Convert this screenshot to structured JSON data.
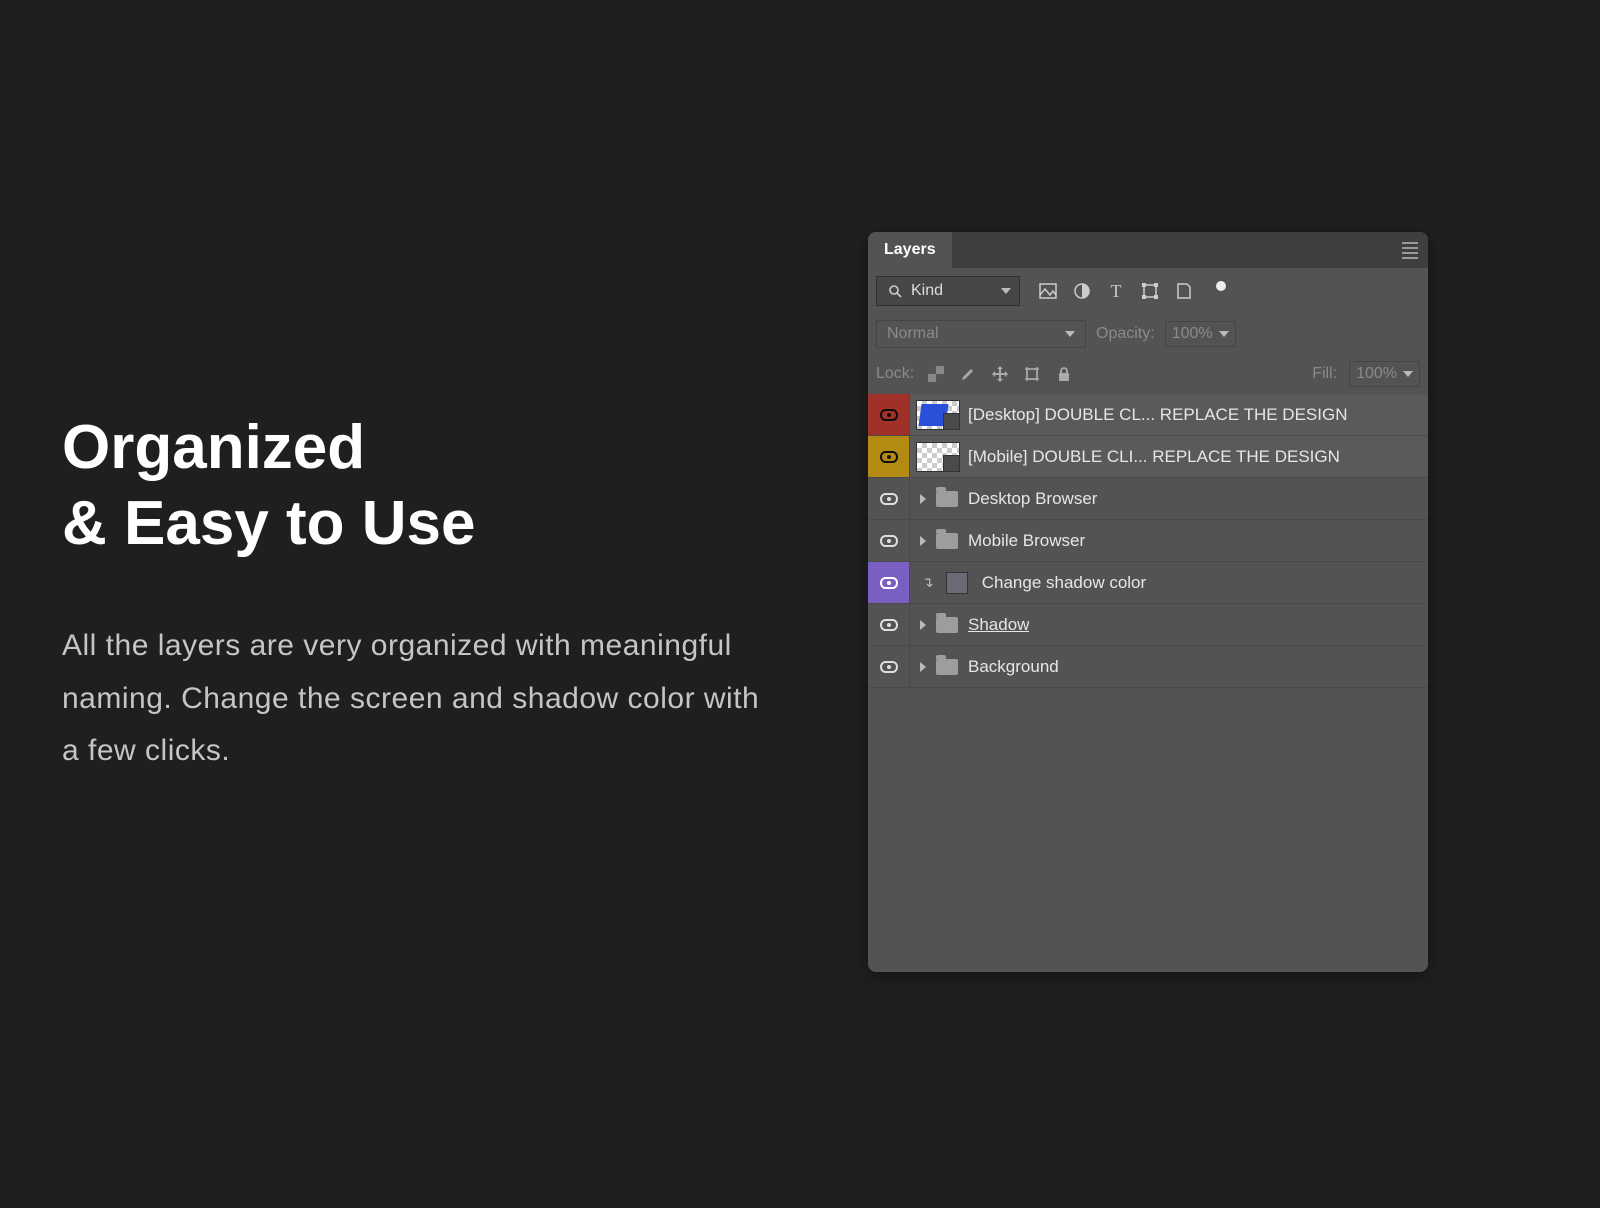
{
  "heading_line1": "Organized",
  "heading_line2": "& Easy to Use",
  "body_text": "All the layers are very organized with meaningful naming. Change the screen and shadow color with a few clicks.",
  "panel": {
    "tab": "Layers",
    "filter": "Kind",
    "blend_mode": "Normal",
    "opacity_label": "Opacity:",
    "opacity_value": "100%",
    "lock_label": "Lock:",
    "fill_label": "Fill:",
    "fill_value": "100%",
    "layers": [
      {
        "name": "[Desktop] DOUBLE CL... REPLACE THE DESIGN"
      },
      {
        "name": "[Mobile] DOUBLE CLI... REPLACE THE DESIGN"
      },
      {
        "name": "Desktop Browser"
      },
      {
        "name": "Mobile Browser"
      },
      {
        "name": "Change shadow color"
      },
      {
        "name": "Shadow"
      },
      {
        "name": "Background"
      }
    ]
  }
}
